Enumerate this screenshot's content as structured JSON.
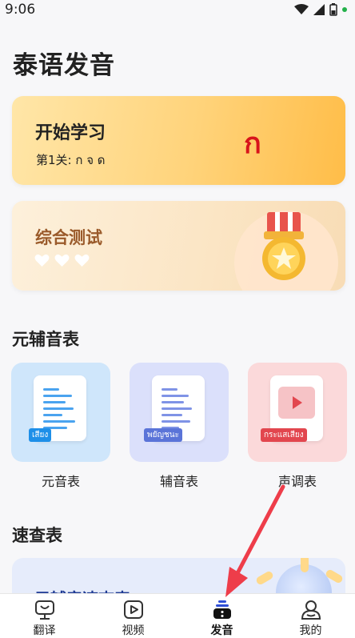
{
  "status_bar": {
    "time": "9:06"
  },
  "page": {
    "title": "泰语发音"
  },
  "start_card": {
    "title": "开始学习",
    "subtitle": "第1关: ก จ ด",
    "glyph": "ก"
  },
  "test_card": {
    "title": "综合测试"
  },
  "sections": {
    "tables": "元辅音表",
    "quick": "速查表"
  },
  "tiles": [
    {
      "tag": "เสียง",
      "label": "元音表",
      "tag_color": "#1e8fe8"
    },
    {
      "tag": "พยัญชนะ",
      "label": "辅音表",
      "tag_color": "#5a74d8"
    },
    {
      "tag": "กระแสเสียง",
      "label": "声调表",
      "tag_color": "#e2464e"
    }
  ],
  "quick_card": {
    "title": "元辅音速查表"
  },
  "tabs": [
    {
      "label": "翻译",
      "icon": "translate-icon"
    },
    {
      "label": "视频",
      "icon": "video-icon"
    },
    {
      "label": "发音",
      "icon": "pronounce-icon",
      "active": true
    },
    {
      "label": "我的",
      "icon": "profile-icon"
    }
  ],
  "colors": {
    "arrow": "#ee3d4a",
    "accent": "#ffbd48"
  }
}
